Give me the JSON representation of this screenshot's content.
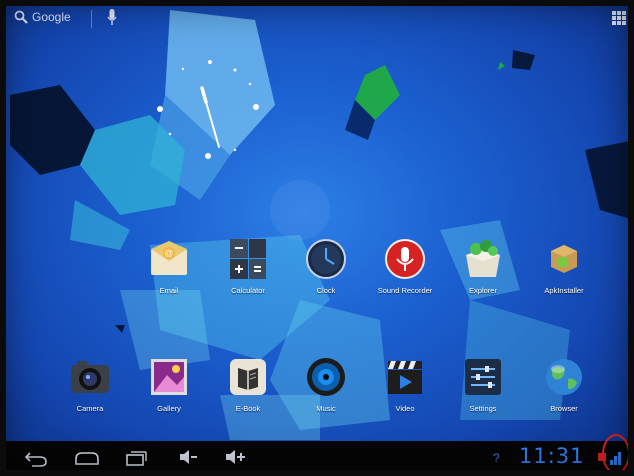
{
  "search": {
    "label": "Google"
  },
  "apps_row1": [
    {
      "label": "Email",
      "icon": "email-icon"
    },
    {
      "label": "Calculator",
      "icon": "calculator-icon"
    },
    {
      "label": "Clock",
      "icon": "clock-icon"
    },
    {
      "label": "Sound Recorder",
      "icon": "microphone-icon"
    },
    {
      "label": "Explorer",
      "icon": "folder-explorer-icon"
    },
    {
      "label": "ApkInstaller",
      "icon": "package-installer-icon"
    }
  ],
  "apps_row2": [
    {
      "label": "Camera",
      "icon": "camera-icon"
    },
    {
      "label": "Gallery",
      "icon": "gallery-icon"
    },
    {
      "label": "E-Book",
      "icon": "book-icon"
    },
    {
      "label": "Music",
      "icon": "music-speaker-icon"
    },
    {
      "label": "Video",
      "icon": "video-clapper-icon"
    },
    {
      "label": "Settings",
      "icon": "settings-sliders-icon"
    },
    {
      "label": "Browser",
      "icon": "globe-icon"
    }
  ],
  "status": {
    "time": "11:31",
    "unknown_indicator": "?"
  },
  "colors": {
    "accent": "#2f7ff0",
    "wallpaper": "#1b5fd0",
    "navbar": "#050505",
    "highlight_circle": "#e0221b"
  }
}
